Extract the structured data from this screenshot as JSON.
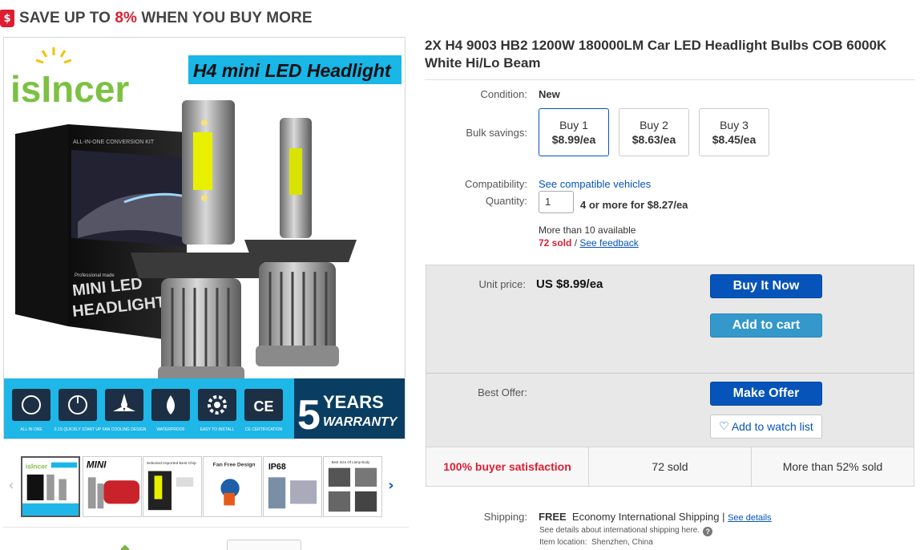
{
  "promo": {
    "icon": "$",
    "prefix": "SAVE UP TO ",
    "percent": "8%",
    "suffix": " WHEN YOU BUY MORE"
  },
  "image": {
    "brand": "isIncer",
    "banner": "H4 mini LED Headlight",
    "box_text_1": "MINI LED",
    "box_text_2": "HEADLIGHT",
    "box_small": "Professional made",
    "box_top": "ALL-IN-ONE CONVERSION KIT",
    "features": [
      "ALL IN ONE",
      "0.1S QUICKLY START UP",
      "FAN COOLING DESIGN",
      "WATERPROOF",
      "EASY TO INSTALL",
      "CE CERTIFICATION"
    ],
    "warranty_num": "5",
    "warranty_1": "YEARS",
    "warranty_2": "WARRANTY"
  },
  "thumbnails": [
    {
      "label": "isIncer"
    },
    {
      "label": "MINI"
    },
    {
      "label": "Selected Imported Best Chip"
    },
    {
      "label": "Fan Free Design"
    },
    {
      "label": "IP68"
    },
    {
      "label": "Best Size Of Lamp Body"
    }
  ],
  "product": {
    "title": "2X H4 9003 HB2 1200W 180000LM Car LED Headlight Bulbs COB 6000K White Hi/Lo Beam",
    "condition_label": "Condition:",
    "condition": "New",
    "bulk_label": "Bulk savings:",
    "bulk_options": [
      {
        "label": "Buy 1",
        "price": "$8.99/ea"
      },
      {
        "label": "Buy 2",
        "price": "$8.63/ea"
      },
      {
        "label": "Buy 3",
        "price": "$8.45/ea"
      }
    ],
    "compat_label": "Compatibility:",
    "compat_link": "See compatible vehicles",
    "qty_label": "Quantity:",
    "qty_value": "1",
    "qty_deal": "4 or more for $8.27/ea",
    "availability": "More than 10 available",
    "sold": "72 sold",
    "sold_sep": " / ",
    "feedback": "See feedback"
  },
  "buybox": {
    "unit_label": "Unit price:",
    "unit_price": "US $8.99/ea",
    "buy_now": "Buy It Now",
    "add_cart": "Add to cart",
    "offer_label": "Best Offer:",
    "make_offer": "Make Offer",
    "watch": "Add to watch list",
    "stats": [
      "100% buyer satisfaction",
      "72 sold",
      "More than 52% sold"
    ]
  },
  "shipping": {
    "label": "Shipping:",
    "free": "FREE",
    "method": "Economy International Shipping |",
    "details": "See details",
    "note": "See details about international shipping here.",
    "location_label": "Item location:",
    "location": "Shenzhen, China"
  },
  "colors": {
    "accent": "#0654ba",
    "buy_light": "#3498ca",
    "alert": "#dd1e31",
    "banner_cyan": "#19b6e8"
  }
}
